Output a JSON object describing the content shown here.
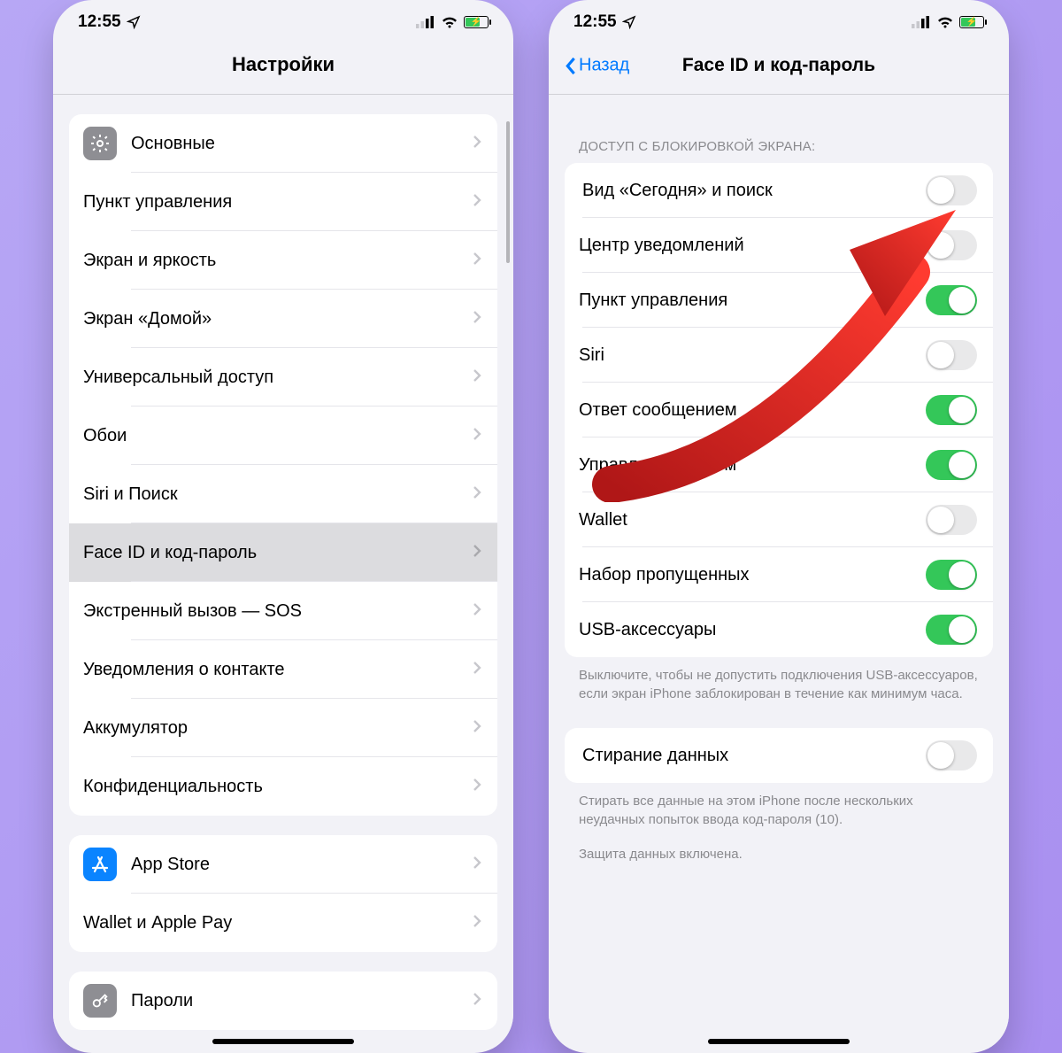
{
  "status": {
    "time": "12:55"
  },
  "left_screen": {
    "title": "Настройки",
    "group1": [
      {
        "id": "general",
        "label": "Основные"
      },
      {
        "id": "control",
        "label": "Пункт управления"
      },
      {
        "id": "display",
        "label": "Экран и яркость"
      },
      {
        "id": "home",
        "label": "Экран «Домой»"
      },
      {
        "id": "accessibility",
        "label": "Универсальный доступ"
      },
      {
        "id": "wallpaper",
        "label": "Обои"
      },
      {
        "id": "siri",
        "label": "Siri и Поиск"
      },
      {
        "id": "faceid",
        "label": "Face ID и код-пароль",
        "selected": true
      },
      {
        "id": "sos",
        "label": "Экстренный вызов — SOS"
      },
      {
        "id": "exposure",
        "label": "Уведомления о контакте"
      },
      {
        "id": "battery",
        "label": "Аккумулятор"
      },
      {
        "id": "privacy",
        "label": "Конфиденциальность"
      }
    ],
    "group2": [
      {
        "id": "appstore",
        "label": "App Store"
      },
      {
        "id": "wallet",
        "label": "Wallet и Apple Pay"
      }
    ],
    "group3_peek": {
      "id": "passwords",
      "label": "Пароли"
    }
  },
  "right_screen": {
    "back": "Назад",
    "title": "Face ID и код-пароль",
    "section_header": "ДОСТУП С БЛОКИРОВКОЙ ЭКРАНА:",
    "toggles": [
      {
        "id": "today",
        "label": "Вид «Сегодня» и поиск",
        "on": false
      },
      {
        "id": "notif",
        "label": "Центр уведомлений",
        "on": false
      },
      {
        "id": "control",
        "label": "Пункт управления",
        "on": true
      },
      {
        "id": "siri",
        "label": "Siri",
        "on": false
      },
      {
        "id": "reply",
        "label": "Ответ сообщением",
        "on": true
      },
      {
        "id": "homekit",
        "label": "Управление домом",
        "on": true
      },
      {
        "id": "wallet",
        "label": "Wallet",
        "on": false
      },
      {
        "id": "missed",
        "label": "Набор пропущенных",
        "on": true
      },
      {
        "id": "usb",
        "label": "USB-аксессуары",
        "on": true
      }
    ],
    "usb_footer": "Выключите, чтобы не допустить подключения USB-аксессуаров, если экран iPhone заблокирован в течение как минимум часа.",
    "erase": {
      "label": "Стирание данных",
      "on": false
    },
    "erase_footer1": "Стирать все данные на этом iPhone после нескольких неудачных попыток ввода код-пароля (10).",
    "erase_footer2": "Защита данных включена."
  }
}
